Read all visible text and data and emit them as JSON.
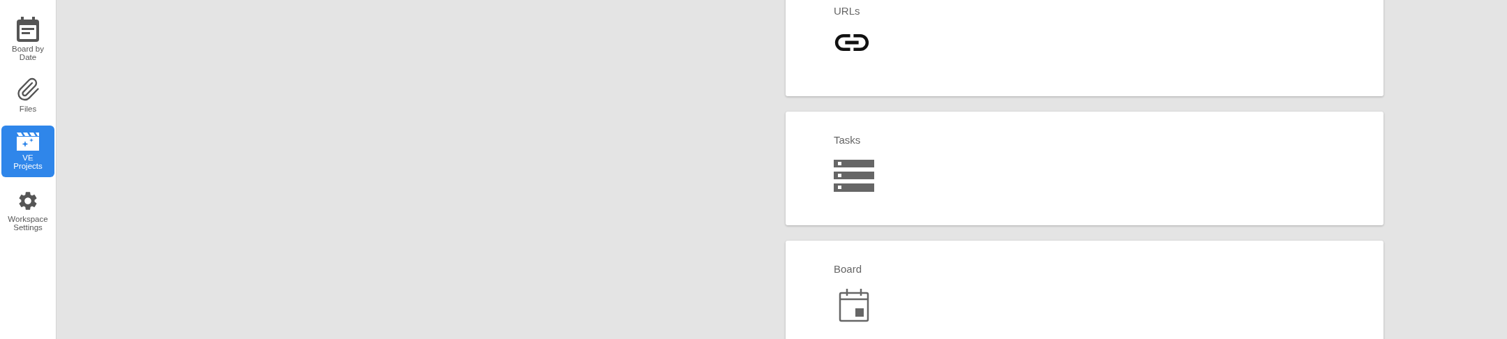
{
  "sidebar": {
    "items": [
      {
        "label": "Board by Date",
        "kind": "calendar-list",
        "selected": false
      },
      {
        "label": "Files",
        "kind": "paperclip",
        "selected": false
      },
      {
        "label": "VE Projects",
        "kind": "clapperboard",
        "selected": true
      },
      {
        "label": "Workspace Settings",
        "kind": "gear",
        "selected": false
      }
    ]
  },
  "cards": [
    {
      "title": "URLs",
      "kind": "link"
    },
    {
      "title": "Tasks",
      "kind": "list"
    },
    {
      "title": "Board",
      "kind": "calendar"
    }
  ]
}
